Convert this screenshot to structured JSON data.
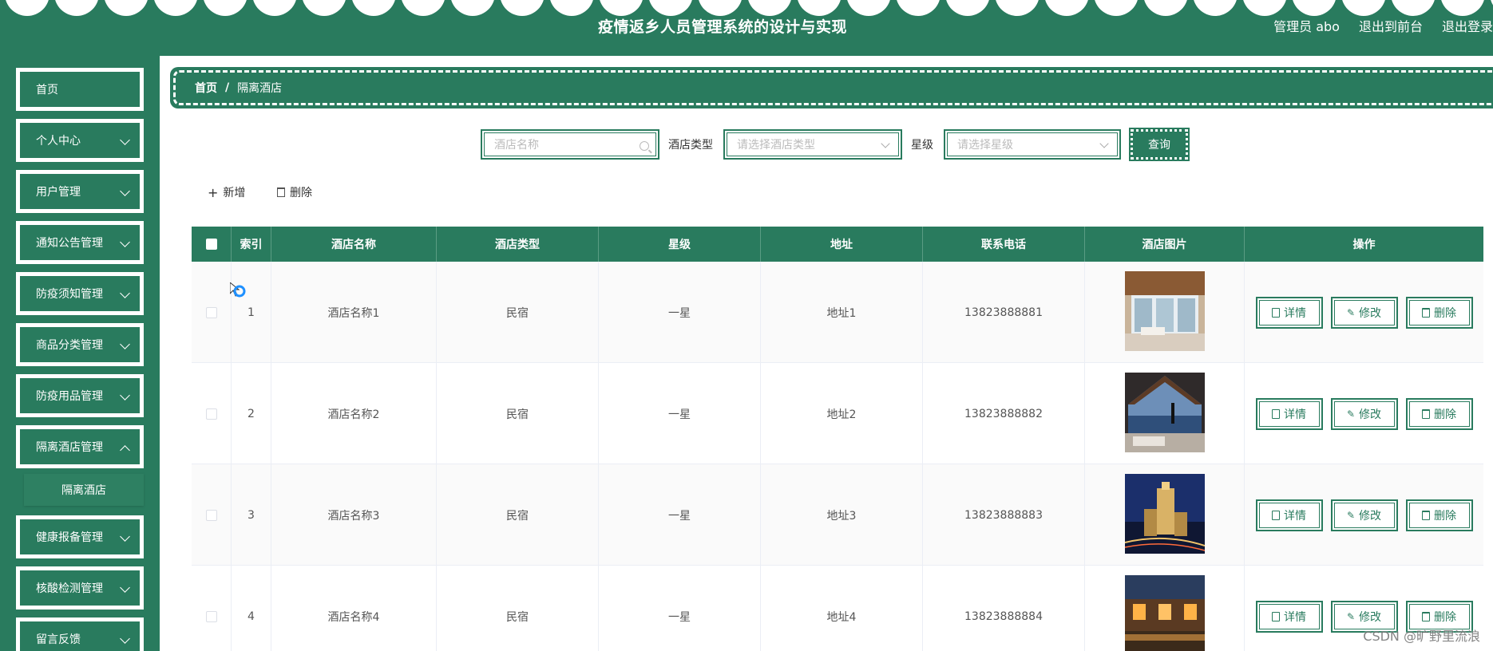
{
  "header": {
    "title": "疫情返乡人员管理系统的设计与实现",
    "links": [
      "管理员 abo",
      "退出到前台",
      "退出登录"
    ]
  },
  "sidebar": {
    "items": [
      {
        "label": "首页",
        "has_arrow": false
      },
      {
        "label": "个人中心",
        "has_arrow": true
      },
      {
        "label": "用户管理",
        "has_arrow": true
      },
      {
        "label": "通知公告管理",
        "has_arrow": true
      },
      {
        "label": "防疫须知管理",
        "has_arrow": true
      },
      {
        "label": "商品分类管理",
        "has_arrow": true
      },
      {
        "label": "防疫用品管理",
        "has_arrow": true
      },
      {
        "label": "隔离酒店管理",
        "has_arrow": true
      },
      {
        "label": "健康报备管理",
        "has_arrow": true
      },
      {
        "label": "核酸检测管理",
        "has_arrow": true
      },
      {
        "label": "留言反馈",
        "has_arrow": true
      }
    ],
    "active_sub": "隔离酒店"
  },
  "breadcrumb": {
    "home": "首页",
    "separator": "/",
    "current": "隔离酒店"
  },
  "search": {
    "name_placeholder": "酒店名称",
    "type_label": "酒店类型",
    "type_placeholder": "请选择酒店类型",
    "star_label": "星级",
    "star_placeholder": "请选择星级",
    "query_label": "查询"
  },
  "actions": {
    "add": "新增",
    "delete": "删除"
  },
  "table": {
    "columns": [
      "索引",
      "酒店名称",
      "酒店类型",
      "星级",
      "地址",
      "联系电话",
      "酒店图片",
      "操作"
    ],
    "rows": [
      {
        "index": "1",
        "name": "酒店名称1",
        "type": "民宿",
        "star": "一星",
        "address": "地址1",
        "phone": "13823888881",
        "image": "hotel-interior-room"
      },
      {
        "index": "2",
        "name": "酒店名称2",
        "type": "民宿",
        "star": "一星",
        "address": "地址2",
        "phone": "13823888882",
        "image": "hotel-window-view"
      },
      {
        "index": "3",
        "name": "酒店名称3",
        "type": "民宿",
        "star": "一星",
        "address": "地址3",
        "phone": "13823888883",
        "image": "hotel-night-tower"
      },
      {
        "index": "4",
        "name": "酒店名称4",
        "type": "民宿",
        "star": "一星",
        "address": "地址4",
        "phone": "13823888884",
        "image": "hotel-courtyard-pool"
      }
    ],
    "row_actions": {
      "detail": "详情",
      "edit": "修改",
      "delete": "删除"
    }
  },
  "watermark": "CSDN @旷野里流浪",
  "colors": {
    "primary": "#297b5e",
    "white": "#ffffff"
  }
}
